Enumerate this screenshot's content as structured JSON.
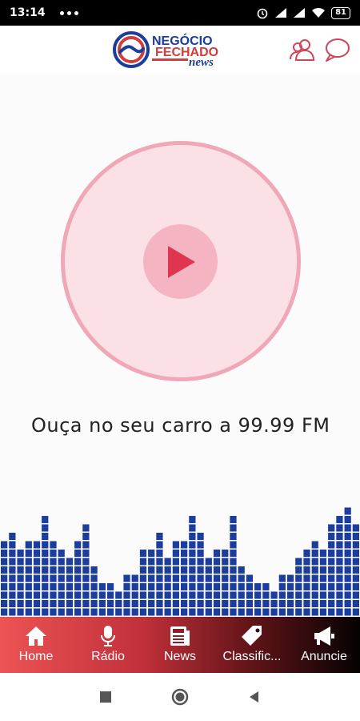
{
  "status_bar": {
    "time": "13:14",
    "battery": "81"
  },
  "header": {
    "logo": {
      "line1": "NEGÓCIO",
      "line2": "FECHADO",
      "line3": "news"
    },
    "icons": [
      "user-profile-icon",
      "chat-bubble-icon"
    ]
  },
  "player": {
    "state_icon": "play-icon",
    "caption": "Ouça no seu carro a 99.99 FM"
  },
  "equalizer": {
    "levels": [
      9,
      10,
      8,
      9,
      9,
      12,
      9,
      8,
      7,
      9,
      11,
      6,
      4,
      4,
      3,
      5,
      5,
      8,
      8,
      10,
      7,
      9,
      9,
      12,
      10,
      7,
      8,
      8,
      12,
      6,
      5,
      4,
      4,
      3,
      5,
      5,
      7,
      8,
      9,
      8,
      11,
      12,
      13,
      11
    ]
  },
  "bottom_nav": {
    "items": [
      {
        "label": "Home",
        "icon": "house-icon"
      },
      {
        "label": "Rádio",
        "icon": "microphone-icon"
      },
      {
        "label": "News",
        "icon": "newspaper-icon"
      },
      {
        "label": "Classific...",
        "icon": "price-tag-icon"
      },
      {
        "label": "Anuncie",
        "icon": "megaphone-icon"
      }
    ]
  },
  "system_nav": {
    "buttons": [
      "recents-square-icon",
      "home-circle-icon",
      "back-triangle-icon"
    ]
  },
  "colors": {
    "equalizer_blue": "#1b3d9e",
    "play_red": "#e0354f",
    "disc_pink": "#fbe0e5",
    "disc_border": "#f0a7b8"
  }
}
